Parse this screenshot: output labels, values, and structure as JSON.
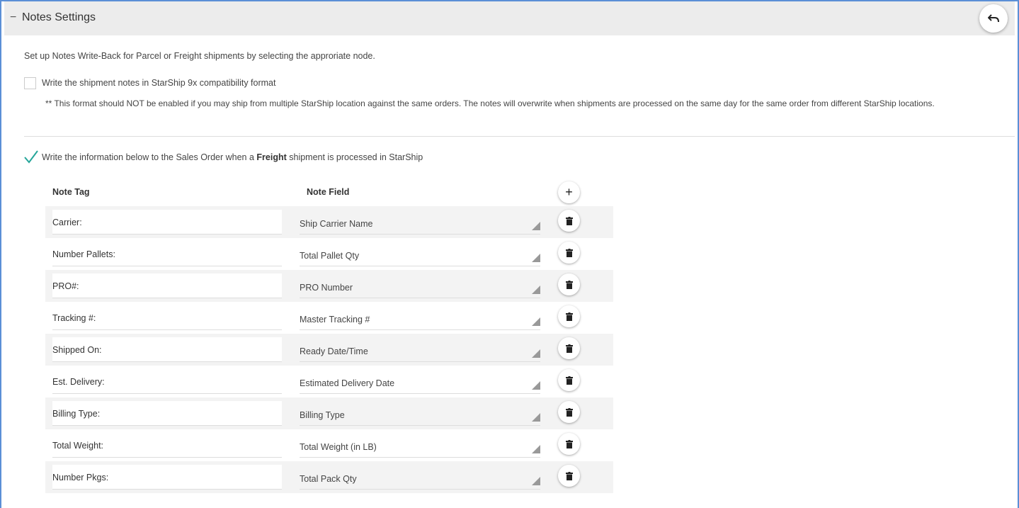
{
  "header": {
    "collapse_icon": "−",
    "title": "Notes Settings",
    "undo_icon": "undo-icon"
  },
  "intro": "Set up Notes Write-Back for Parcel or Freight shipments by selecting the approriate node.",
  "compat": {
    "checked": false,
    "label": "Write the shipment notes in StarShip 9x compatibility format",
    "warning": "** This format should NOT be enabled if you may ship from multiple StarShip location against the same orders. The notes will overwrite when shipments are processed on the same day for the same order from different StarShip locations."
  },
  "freight": {
    "checked": true,
    "label_pre": "Write the information below to the Sales Order when a ",
    "label_bold": "Freight",
    "label_post": " shipment is processed in StarShip"
  },
  "table": {
    "headers": {
      "tag": "Note Tag",
      "field": "Note Field"
    },
    "rows": [
      {
        "tag": "Carrier:",
        "field": "Ship Carrier Name"
      },
      {
        "tag": "Number Pallets:",
        "field": "Total Pallet Qty"
      },
      {
        "tag": "PRO#:",
        "field": "PRO Number"
      },
      {
        "tag": "Tracking #:",
        "field": "Master Tracking #"
      },
      {
        "tag": "Shipped On:",
        "field": "Ready Date/Time"
      },
      {
        "tag": "Est. Delivery:",
        "field": "Estimated Delivery Date"
      },
      {
        "tag": "Billing Type:",
        "field": "Billing Type"
      },
      {
        "tag": "Total Weight:",
        "field": "Total Weight (in LB)"
      },
      {
        "tag": "Number Pkgs:",
        "field": "Total Pack Qty"
      }
    ]
  },
  "colors": {
    "frame": "#5b8fd6",
    "check": "#26a69a",
    "header_bg": "#ececec"
  }
}
